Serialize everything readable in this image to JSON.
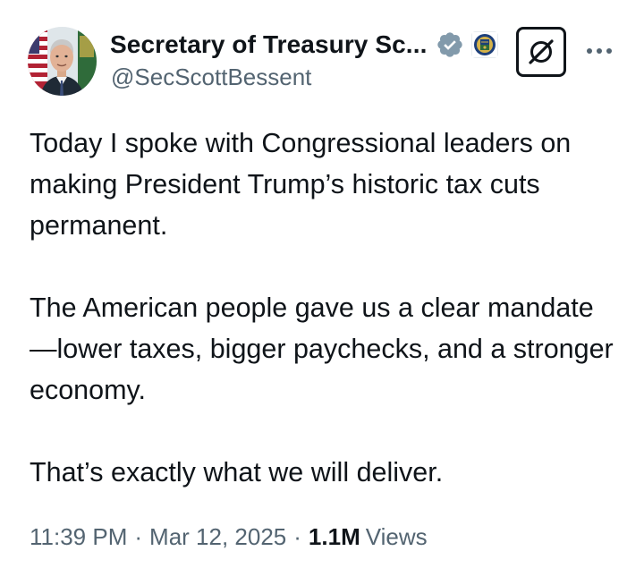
{
  "author": {
    "display_name": "Secretary of Treasury Sc...",
    "handle": "@SecScottBessent",
    "verified": true,
    "verified_color": "#829aab",
    "affiliate_badge": "us-treasury-seal-icon"
  },
  "actions": {
    "grok_icon": "grok-icon",
    "more_icon": "more-options-icon"
  },
  "tweet": {
    "paragraphs": [
      "Today I spoke with Congressional leaders on making President Trump’s historic tax cuts permanent.",
      "The American people gave us a clear mandate—lower taxes, bigger paychecks, and a stronger economy.",
      "That’s exactly what we will deliver."
    ]
  },
  "meta": {
    "time": "11:39 PM",
    "separator": "·",
    "date": "Mar 12, 2025",
    "views_count": "1.1M",
    "views_label": "Views"
  },
  "colors": {
    "text_primary": "#0f1419",
    "text_secondary": "#536471"
  }
}
